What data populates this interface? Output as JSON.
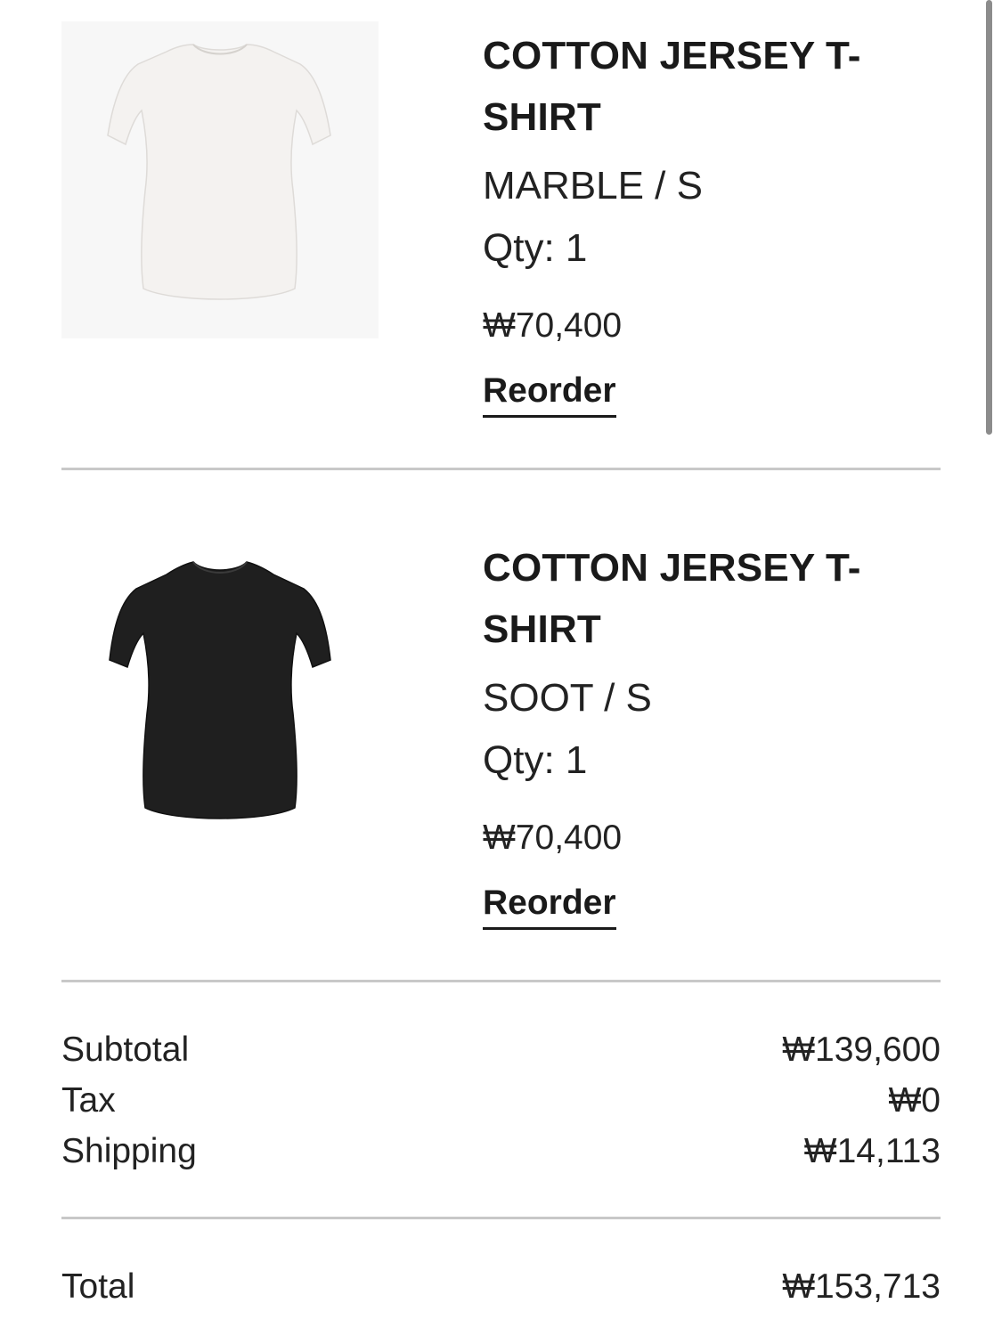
{
  "items": [
    {
      "name": "COTTON JERSEY T-SHIRT",
      "variant": "MARBLE / S",
      "quantity": "Qty: 1",
      "price": "₩70,400",
      "reorder_label": "Reorder",
      "image_alt": "white-tshirt-image",
      "shirt_color": "#f2f0ee"
    },
    {
      "name": "COTTON JERSEY T-SHIRT",
      "variant": "SOOT / S",
      "quantity": "Qty: 1",
      "price": "₩70,400",
      "reorder_label": "Reorder",
      "image_alt": "black-tshirt-image",
      "shirt_color": "#1f1f1f"
    }
  ],
  "summary": {
    "subtotal_label": "Subtotal",
    "subtotal_value": "₩139,600",
    "tax_label": "Tax",
    "tax_value": "₩0",
    "shipping_label": "Shipping",
    "shipping_value": "₩14,113",
    "total_label": "Total",
    "total_value": "₩153,713"
  }
}
